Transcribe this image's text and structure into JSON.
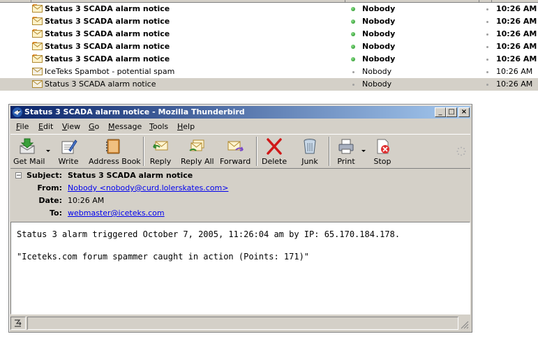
{
  "messages": [
    {
      "subject": "Status 3 SCADA alarm notice",
      "sender": "Nobody",
      "date": "10:26 AM",
      "unread": true
    },
    {
      "subject": "Status 3 SCADA alarm notice",
      "sender": "Nobody",
      "date": "10:26 AM",
      "unread": true
    },
    {
      "subject": "Status 3 SCADA alarm notice",
      "sender": "Nobody",
      "date": "10:26 AM",
      "unread": true
    },
    {
      "subject": "Status 3 SCADA alarm notice",
      "sender": "Nobody",
      "date": "10:26 AM",
      "unread": true
    },
    {
      "subject": "Status 3 SCADA alarm notice",
      "sender": "Nobody",
      "date": "10:26 AM",
      "unread": true
    },
    {
      "subject": "IceTeks Spambot - potential spam",
      "sender": "Nobody",
      "date": "10:26 AM",
      "unread": false
    },
    {
      "subject": "Status 3 SCADA alarm notice",
      "sender": "Nobody",
      "date": "10:26 AM",
      "unread": false,
      "selected": true
    }
  ],
  "window": {
    "title": "Status 3 SCADA alarm notice - Mozilla Thunderbird",
    "minimize": "_",
    "maximize": "□",
    "close": "×"
  },
  "menu": [
    "File",
    "Edit",
    "View",
    "Go",
    "Message",
    "Tools",
    "Help"
  ],
  "toolbar": {
    "get_mail": "Get Mail",
    "write": "Write",
    "address_book": "Address Book",
    "reply": "Reply",
    "reply_all": "Reply All",
    "forward": "Forward",
    "delete": "Delete",
    "junk": "Junk",
    "print": "Print",
    "stop": "Stop"
  },
  "headers": {
    "collapse": "−",
    "subject_label": "Subject:",
    "subject": "Status 3 SCADA alarm notice",
    "from_label": "From:",
    "from": "Nobody <nobody@curd.lolerskates.com>",
    "date_label": "Date:",
    "date": "10:26 AM",
    "to_label": "To:",
    "to": "webmaster@iceteks.com"
  },
  "body": {
    "line1": "Status 3 alarm triggered October 7, 2005, 11:26:04 am by IP: 65.170.184.178.",
    "line2": "\"Iceteks.com forum spammer caught in action (Points: 171)\""
  },
  "colors": {
    "titlebar_start": "#0a246a",
    "titlebar_end": "#a6caf0",
    "chrome": "#d4d0c8",
    "link": "#0000ee",
    "online_dot": "#1c8a1c"
  },
  "icons": [
    "envelope-icon",
    "thunderbird-icon",
    "get-mail-icon",
    "write-icon",
    "address-book-icon",
    "reply-icon",
    "reply-all-icon",
    "forward-icon",
    "delete-icon",
    "junk-icon",
    "print-icon",
    "stop-icon",
    "throbber-icon",
    "offline-icon"
  ]
}
